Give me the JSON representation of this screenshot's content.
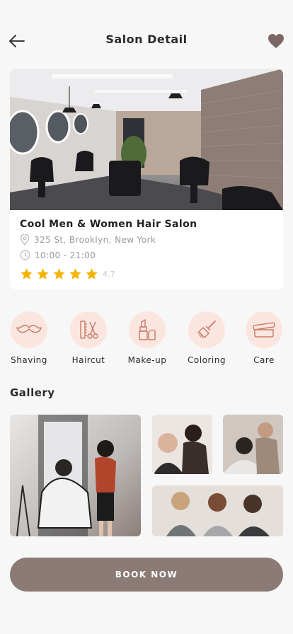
{
  "header": {
    "title": "Salon Detail"
  },
  "salon": {
    "name": "Cool Men & Women Hair Salon",
    "address": "325 St, Brooklyn, New York",
    "hours": "10:00 - 21:00",
    "rating": "4.7",
    "stars": 5
  },
  "services": [
    {
      "label": "Shaving",
      "icon": "mustache-icon"
    },
    {
      "label": "Haircut",
      "icon": "scissors-comb-icon"
    },
    {
      "label": "Make-up",
      "icon": "lipstick-icon"
    },
    {
      "label": "Coloring",
      "icon": "brush-icon"
    },
    {
      "label": "Care",
      "icon": "cream-jar-icon"
    }
  ],
  "gallery": {
    "title": "Gallery"
  },
  "actions": {
    "book_label": "BOOK NOW"
  },
  "colors": {
    "accent": "#8b7a75",
    "service_bg": "#fbe6df",
    "service_icon": "#c47a66",
    "star": "#f5b301",
    "heart": "#7a6763"
  }
}
